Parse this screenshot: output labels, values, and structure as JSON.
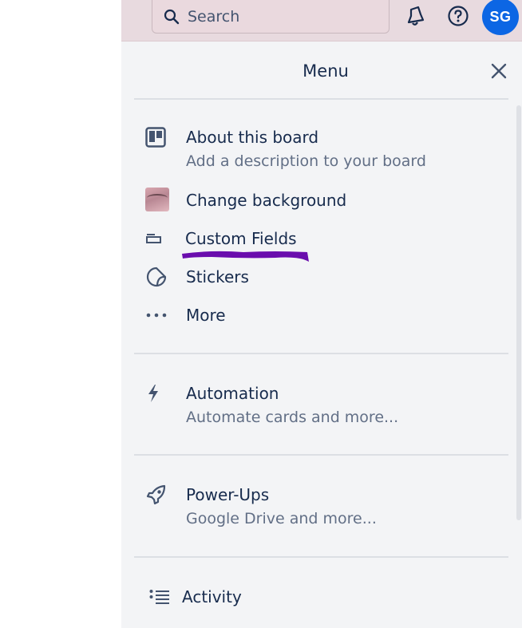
{
  "header": {
    "search_placeholder": "Search",
    "avatar_initials": "SG",
    "accent": "#0c66e4"
  },
  "menu": {
    "title": "Menu",
    "items": [
      {
        "label": "About this board",
        "desc": "Add a description to your board",
        "icon": "board-icon"
      },
      {
        "label": "Change background",
        "icon": "background-thumbnail"
      },
      {
        "label": "Custom Fields",
        "icon": "custom-fields-icon"
      },
      {
        "label": "Stickers",
        "icon": "sticker-icon"
      },
      {
        "label": "More",
        "icon": "more-icon"
      }
    ],
    "automation": {
      "label": "Automation",
      "desc": "Automate cards and more...",
      "icon": "lightning-icon"
    },
    "powerups": {
      "label": "Power-Ups",
      "desc": "Google Drive and more...",
      "icon": "rocket-icon"
    },
    "activity": {
      "label": "Activity",
      "icon": "activity-list-icon"
    }
  },
  "annotation_color": "#6a0dad"
}
